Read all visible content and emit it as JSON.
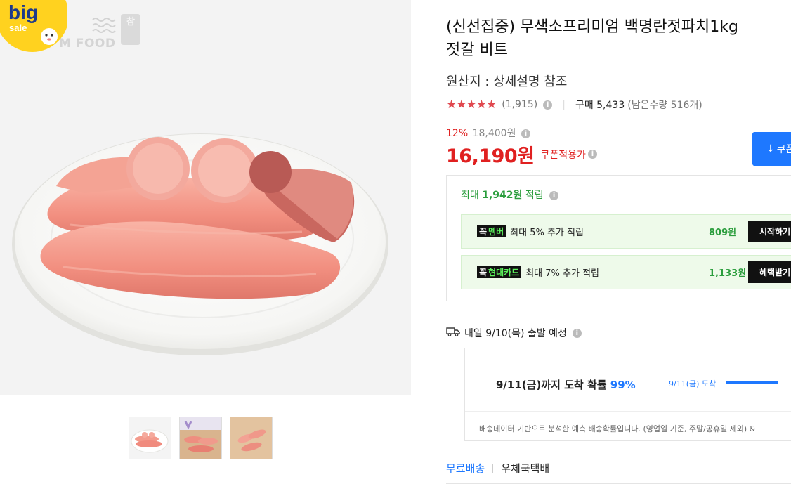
{
  "badge": {
    "big": "big",
    "sale": "sale"
  },
  "brand": {
    "text": "M FOOD",
    "seal": "참"
  },
  "product": {
    "title_line1": "(신선집중) 무색소프리미엄 백명란젓파치1kg",
    "title_line2": "젓갈 비트",
    "origin": "원산지 : 상세설명 참조",
    "stars": "★★★★★",
    "rating_count": "(1,915)",
    "buy_count": "구매 5,433",
    "stock": "(남은수량 516개)",
    "discount": "12%",
    "original_price": "18,400원",
    "price": "16,190원",
    "coupon_label": "쿠폰적용가",
    "coupon_button": "쿠폰"
  },
  "points": {
    "prefix": "최대",
    "amount": "1,942원",
    "suffix": "적립",
    "benefits": [
      {
        "chip_mark": "꼭",
        "chip": "멤버",
        "text": "최대 5% 추가 적립",
        "amount": "809원",
        "button": "시작하기"
      },
      {
        "chip_mark": "꼭",
        "chip": "현대카드",
        "text": "최대 7% 추가 적립",
        "amount": "1,133원",
        "button": "혜택받기"
      }
    ]
  },
  "shipping": {
    "departure": "내일 9/10(목) 출발 예정",
    "arrival_text": "9/11(금)까지 도착 확률",
    "arrival_pct": "99%",
    "chart_label": "9/11(금) 도착",
    "note": "배송데이터 기반으로 분석한 예측 배송확률입니다. (영업일 기준, 주말/공휴일 제외) &",
    "free_shipping": "무료배송",
    "carrier": "우체국택배"
  },
  "colors": {
    "accent": "#1e78ff",
    "price": "#e02020",
    "green": "#2a9d3c",
    "badge_yellow": "#ffd21f"
  },
  "icons": [
    "info-icon",
    "truck-icon",
    "download-icon"
  ]
}
